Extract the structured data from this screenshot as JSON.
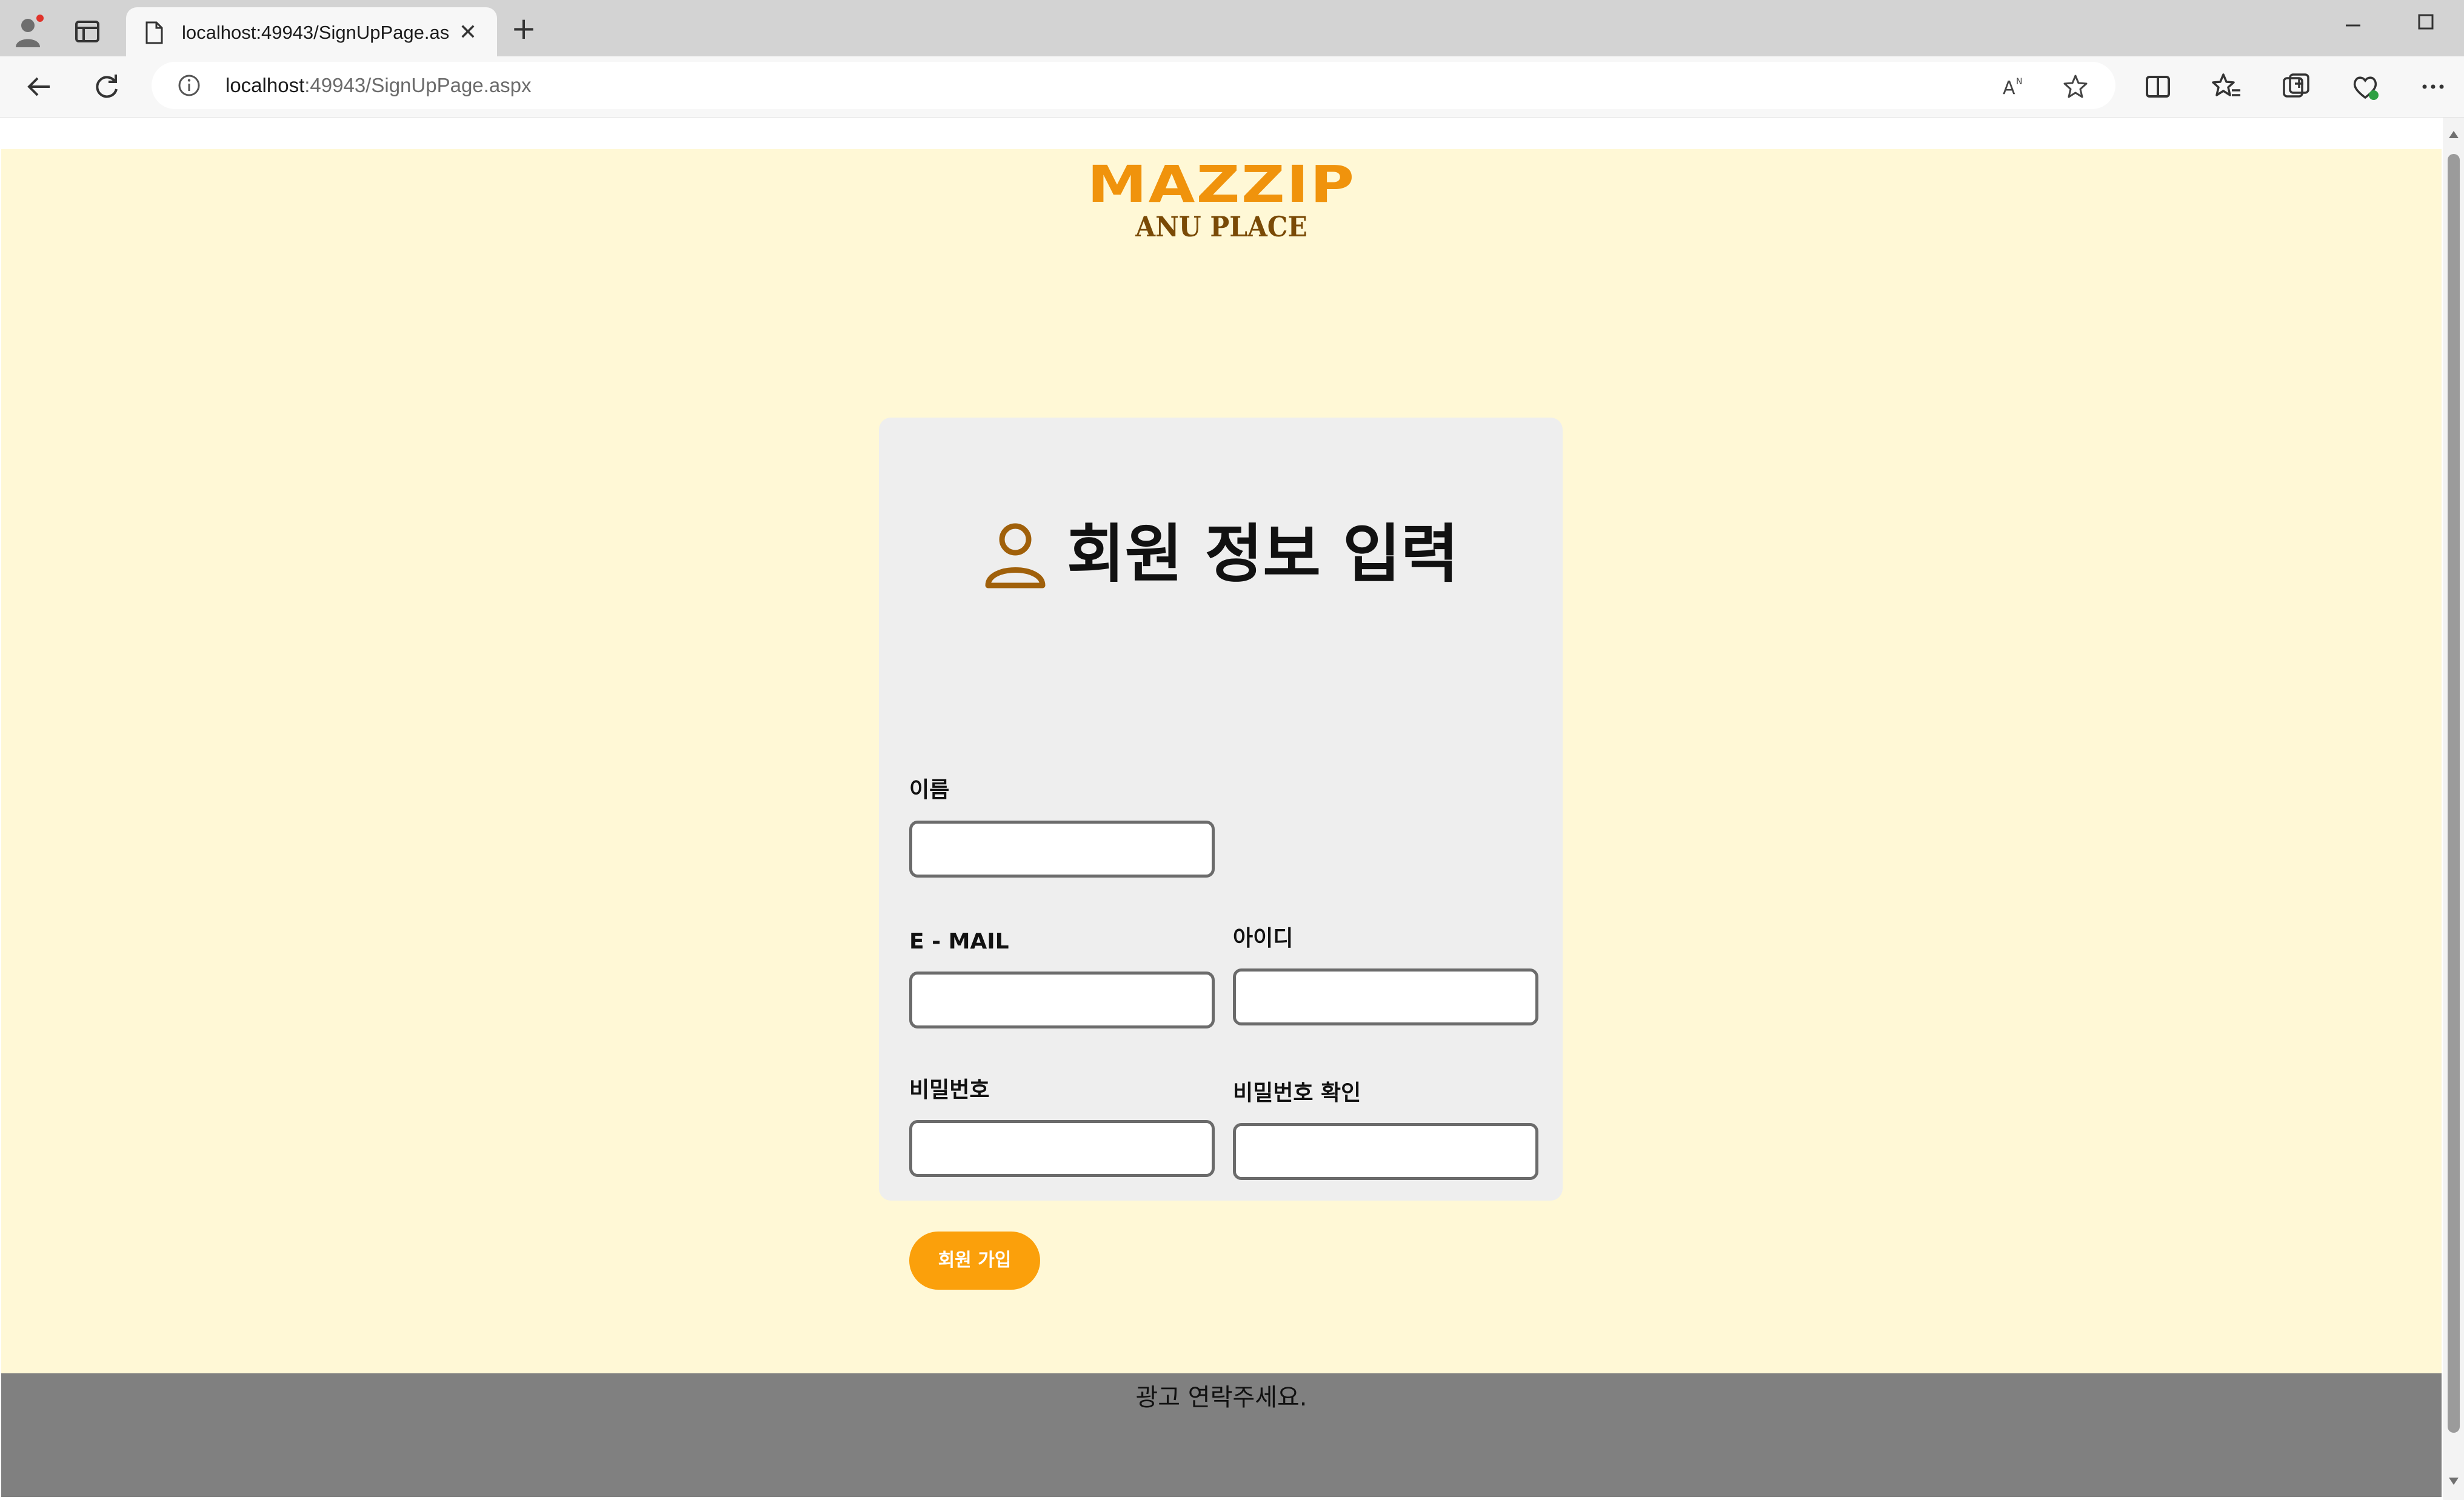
{
  "browser": {
    "tab_title": "localhost:49943/SignUpPage.aspx",
    "tab_close_glyph": "✕",
    "new_tab_glyph": "+",
    "url_host": "localhost",
    "url_path": ":49943/SignUpPage.aspx",
    "icons": [
      "profile-icon",
      "tab-actions-icon",
      "page-icon",
      "back-icon",
      "refresh-icon",
      "info-icon",
      "read-aloud-icon",
      "favorite-star-icon",
      "split-screen-icon",
      "favorites-icon",
      "collections-icon",
      "browser-essentials-icon",
      "more-icon",
      "minimize-icon",
      "maximize-icon"
    ]
  },
  "header": {
    "logo_main": "MAZZIP",
    "logo_sub": "ANU PLACE"
  },
  "form": {
    "title": "회원 정보 입력",
    "title_icon": "user-icon",
    "name_label": "이름",
    "email_label": "E - MAIL",
    "id_label": "아이디",
    "password_label": "비밀번호",
    "password_confirm_label": "비밀번호 확인",
    "submit_label": "회원 가입",
    "name_value": "",
    "email_value": "",
    "id_value": "",
    "password_value": "",
    "password_confirm_value": ""
  },
  "footer": {
    "text": "광고 연락주세요."
  },
  "colors": {
    "page_background": "#fff8d6",
    "card_background": "#eeeeee",
    "accent": "#fba00b",
    "logo": "#f0930c",
    "footer": "#808080"
  }
}
